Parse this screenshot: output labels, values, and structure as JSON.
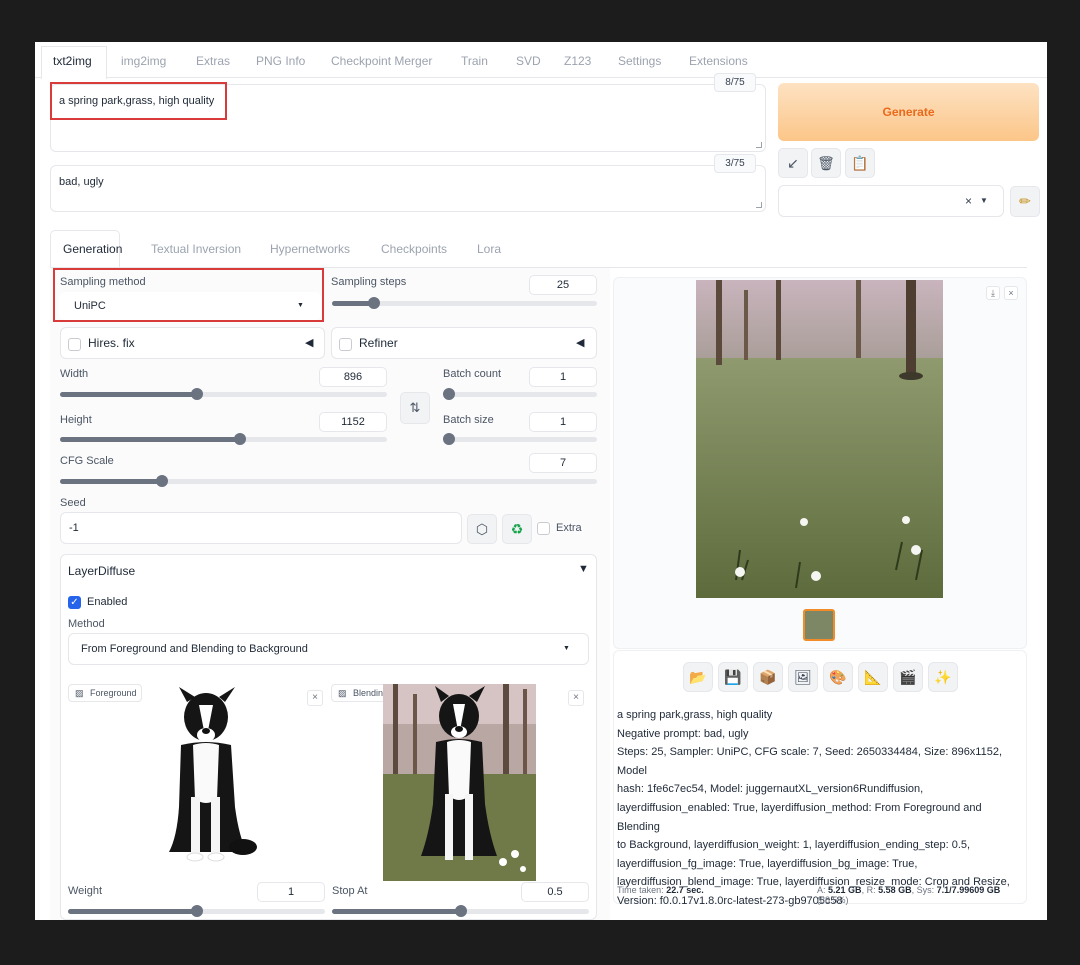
{
  "tabs": [
    "txt2img",
    "img2img",
    "Extras",
    "PNG Info",
    "Checkpoint Merger",
    "Train",
    "SVD",
    "Z123",
    "Settings",
    "Extensions"
  ],
  "prompt": {
    "value": "a spring park,grass, high quality",
    "counter": "8/75"
  },
  "negative_prompt": {
    "value": "bad, ugly",
    "counter": "3/75"
  },
  "generate_label": "Generate",
  "style_select_clear": "×",
  "sub_tabs": [
    "Generation",
    "Textual Inversion",
    "Hypernetworks",
    "Checkpoints",
    "Lora"
  ],
  "sampling": {
    "label": "Sampling method",
    "value": "UniPC"
  },
  "steps": {
    "label": "Sampling steps",
    "value": "25"
  },
  "hires": {
    "label": "Hires. fix"
  },
  "refiner": {
    "label": "Refiner"
  },
  "width": {
    "label": "Width",
    "value": "896"
  },
  "height": {
    "label": "Height",
    "value": "1152"
  },
  "batch_count": {
    "label": "Batch count",
    "value": "1"
  },
  "batch_size": {
    "label": "Batch size",
    "value": "1"
  },
  "cfg": {
    "label": "CFG Scale",
    "value": "7"
  },
  "seed": {
    "label": "Seed",
    "value": "-1",
    "extra": "Extra"
  },
  "layerdiffuse": {
    "title": "LayerDiffuse",
    "enabled": "Enabled",
    "method_label": "Method",
    "method_value": "From Foreground and Blending to Background",
    "foreground_label": "Foreground",
    "blending_label": "Blending",
    "weight": {
      "label": "Weight",
      "value": "1"
    },
    "stop_at": {
      "label": "Stop At",
      "value": "0.5"
    }
  },
  "output": {
    "info_lines": [
      "a spring park,grass, high quality",
      "Negative prompt: bad, ugly",
      "Steps: 25, Sampler: UniPC, CFG scale: 7, Seed: 2650334484, Size: 896x1152, Model",
      "hash: 1fe6c7ec54, Model: juggernautXL_version6Rundiffusion,",
      "layerdiffusion_enabled: True, layerdiffusion_method: From Foreground and Blending",
      "to Background, layerdiffusion_weight: 1, layerdiffusion_ending_step: 0.5,",
      "layerdiffusion_fg_image: True, layerdiffusion_bg_image: True,",
      "layerdiffusion_blend_image: True, layerdiffusion_resize_mode: Crop and Resize,",
      "Version: f0.0.17v1.8.0rc-latest-273-gb9705c58"
    ],
    "time_label": "Time taken:",
    "time_value": "22.7 sec.",
    "mem_a_label": "A:",
    "mem_a": "5.21 GB",
    "mem_r_label": "R:",
    "mem_r": "5.58 GB",
    "mem_sys_label": "Sys:",
    "mem_sys": "7.1/7.99609 GB",
    "mem_pct": "(88.5%)"
  },
  "sliders": {
    "steps": 0.16,
    "width": 0.42,
    "height": 0.55,
    "cfg": 0.19,
    "batch_count": 0.0,
    "batch_size": 0.0,
    "weight": 0.5,
    "stop_at": 0.5
  },
  "colors": {
    "accent": "#ea6a1b",
    "highlight": "#d93a3a",
    "checkbox": "#2563eb"
  }
}
